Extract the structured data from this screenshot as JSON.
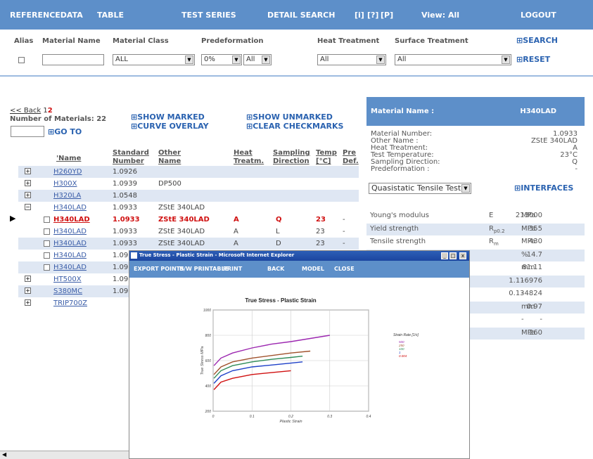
{
  "nav": {
    "items": [
      "REFERENCEDATA",
      "TABLE",
      "TEST SERIES",
      "DETAIL SEARCH",
      "[i]",
      "[?]",
      "[P]",
      "View: All",
      "LOGOUT"
    ]
  },
  "filters": {
    "labels": [
      "Alias",
      "Material Name",
      "Material Class",
      "Predeformation",
      "Heat Treatment",
      "Surface Treatment"
    ],
    "material_class": "ALL",
    "predeformation": "0%",
    "predeformation_dir": "All",
    "heat_treatment": "All",
    "surface_treatment": "All",
    "material_name": "",
    "search": "SEARCH",
    "reset": "RESET"
  },
  "list": {
    "back": "<< Back",
    "pages": [
      "1",
      "2"
    ],
    "count": "Number of Materials: 22",
    "goto": "GO TO",
    "show_marked": "SHOW MARKED",
    "curve_overlay": "CURVE OVERLAY",
    "show_unmarked": "SHOW UNMARKED",
    "clear_checkmarks": "CLEAR CHECKMARKS",
    "headers": {
      "name": "'Name",
      "std1": "Standard",
      "std2": "Number",
      "other1": "Other",
      "other2": "Name",
      "heat1": "Heat",
      "heat2": "Treatm.",
      "samp1": "Sampling",
      "samp2": "Direction",
      "temp1": "Temp",
      "temp2": "[°C]",
      "pre1": "Pre",
      "pre2": "Def."
    },
    "rows": [
      {
        "pm": "+",
        "name": "H260YD",
        "std": "1.0926",
        "other": "",
        "heat": "",
        "dir": "",
        "temp": "",
        "pre": ""
      },
      {
        "pm": "+",
        "name": "H300X",
        "std": "1.0939",
        "other": "DP500",
        "heat": "",
        "dir": "",
        "temp": "",
        "pre": ""
      },
      {
        "pm": "+",
        "name": "H320LA",
        "std": "1.0548",
        "other": "",
        "heat": "",
        "dir": "",
        "temp": "",
        "pre": ""
      },
      {
        "pm": "−",
        "name": "H340LAD",
        "std": "1.0933",
        "other": "ZStE 340LAD",
        "heat": "",
        "dir": "",
        "temp": "",
        "pre": ""
      },
      {
        "pm": "",
        "cb": true,
        "sel": true,
        "name": "H340LAD",
        "std": "1.0933",
        "other": "ZStE 340LAD",
        "heat": "A",
        "dir": "Q",
        "temp": "23",
        "pre": "-"
      },
      {
        "pm": "",
        "cb": true,
        "name": "H340LAD",
        "std": "1.0933",
        "other": "ZStE 340LAD",
        "heat": "A",
        "dir": "L",
        "temp": "23",
        "pre": "-"
      },
      {
        "pm": "",
        "cb": true,
        "name": "H340LAD",
        "std": "1.0933",
        "other": "ZStE 340LAD",
        "heat": "A",
        "dir": "D",
        "temp": "23",
        "pre": "-"
      },
      {
        "pm": "",
        "cb": true,
        "name": "H340LAD",
        "std": "1.09",
        "other": "",
        "heat": "",
        "dir": "",
        "temp": "",
        "pre": ""
      },
      {
        "pm": "",
        "cb": true,
        "name": "H340LAD",
        "std": "1.09",
        "other": "",
        "heat": "",
        "dir": "",
        "temp": "",
        "pre": ""
      },
      {
        "pm": "+",
        "name": "HT500X",
        "std": "1.09",
        "other": "",
        "heat": "",
        "dir": "",
        "temp": "",
        "pre": ""
      },
      {
        "pm": "+",
        "name": "S380MC",
        "std": "1.09",
        "other": "",
        "heat": "",
        "dir": "",
        "temp": "",
        "pre": ""
      },
      {
        "pm": "+",
        "name": "TRIP700Z",
        "std": "",
        "other": "",
        "heat": "",
        "dir": "",
        "temp": "",
        "pre": ""
      }
    ]
  },
  "panel": {
    "header_label": "Material Name :",
    "header_value": "H340LAD",
    "props": [
      {
        "k": "Material Number:",
        "v": "1.0933"
      },
      {
        "k": "Other Name :",
        "v": "ZStE 340LAD"
      },
      {
        "k": "Heat Treatment:",
        "v": "A"
      },
      {
        "k": "Test Temperature:",
        "v": "23°C"
      },
      {
        "k": "Sampling Direction:",
        "v": "Q"
      },
      {
        "k": "Predeformation :",
        "v": "-"
      }
    ],
    "test_select": "Quasistatic Tensile Test",
    "interfaces": "INTERFACES",
    "mech": [
      {
        "n": "Young's modulus",
        "s": "E",
        "sub": "",
        "v": "213000",
        "u": "MPa"
      },
      {
        "n": "Yield strength",
        "s": "R",
        "sub": "p0.2",
        "v": "355",
        "u": "MPa"
      },
      {
        "n": "Tensile strength",
        "s": "R",
        "sub": "m",
        "v": "430",
        "u": "MPa"
      },
      {
        "n": "",
        "s": "",
        "sub": "",
        "v": "14.7",
        "u": "%"
      },
      {
        "n": "",
        "s": "",
        "sub": "",
        "v": "81.11",
        "u": "mm"
      },
      {
        "n": "",
        "s": "",
        "sub": "",
        "v": "1.116976",
        "u": "-"
      },
      {
        "n": "",
        "s": "",
        "sub": "",
        "v": "0.134824",
        "u": "-"
      },
      {
        "n": "",
        "s": "",
        "sub": "",
        "v": "0.97",
        "u": "mm"
      },
      {
        "n": "",
        "s": "",
        "sub": "",
        "v": "-",
        "u": "-"
      },
      {
        "n": "",
        "s": "",
        "sub": "",
        "v": "260",
        "u": "MPa"
      },
      {
        "n": "",
        "s": "",
        "sub": "",
        "v": "",
        "u": ""
      }
    ]
  },
  "popup": {
    "title": "True Stress - Plastic Strain - Microsoft Internet Explorer",
    "buttons": [
      "EXPORT POINTS",
      "B/W PRINTABLE",
      "PRINT",
      "BACK",
      "MODEL",
      "CLOSE"
    ],
    "win_buttons": [
      "_",
      "□",
      "x"
    ]
  },
  "chart_data": {
    "type": "line",
    "title": "True Stress - Plastic Strain",
    "xlabel": "Plastic Strain",
    "ylabel": "True Stress MPa",
    "xlim": [
      0,
      0.4
    ],
    "ylim": [
      200,
      1000
    ],
    "xticks": [
      "0",
      "0.1",
      "0.2",
      "0.3",
      "0.4"
    ],
    "yticks": [
      "200",
      "400",
      "600",
      "800",
      "1000"
    ],
    "grid": true,
    "legend_title": "Strain Rate [1/s]",
    "legend_position": "right",
    "series": [
      {
        "name": "500",
        "color": "#9c27b0",
        "x": [
          0.002,
          0.02,
          0.05,
          0.1,
          0.15,
          0.2,
          0.25,
          0.3
        ],
        "y": [
          560,
          620,
          660,
          700,
          730,
          750,
          775,
          800
        ]
      },
      {
        "name": "250",
        "color": "#a0522d",
        "x": [
          0.002,
          0.02,
          0.05,
          0.1,
          0.15,
          0.2,
          0.25
        ],
        "y": [
          490,
          550,
          590,
          620,
          640,
          660,
          675
        ]
      },
      {
        "name": "100",
        "color": "#2e8b57",
        "x": [
          0.002,
          0.02,
          0.05,
          0.1,
          0.15,
          0.2,
          0.23
        ],
        "y": [
          460,
          520,
          560,
          590,
          610,
          625,
          635
        ]
      },
      {
        "name": "1",
        "color": "#1e40c8",
        "x": [
          0.002,
          0.02,
          0.05,
          0.1,
          0.15,
          0.2,
          0.23
        ],
        "y": [
          420,
          480,
          520,
          550,
          565,
          580,
          590
        ]
      },
      {
        "name": "0.004",
        "color": "#d01010",
        "x": [
          0.002,
          0.02,
          0.05,
          0.1,
          0.15,
          0.2
        ],
        "y": [
          370,
          430,
          460,
          490,
          505,
          520
        ]
      }
    ]
  }
}
